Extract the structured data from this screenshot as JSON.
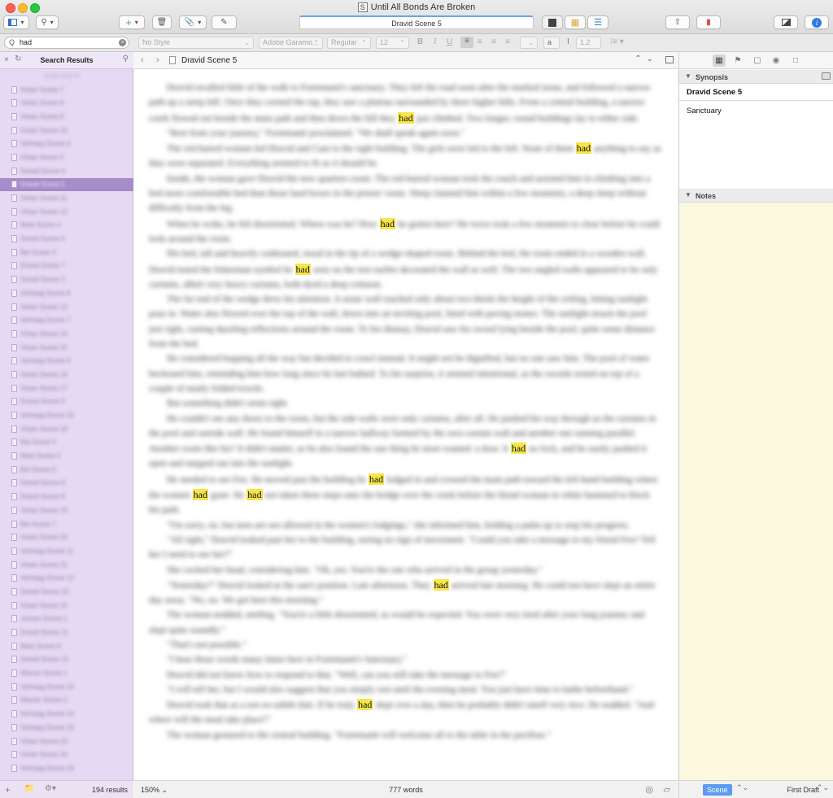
{
  "window": {
    "title": "Until All Bonds Are Broken",
    "doc_field": "Dravid Scene 5"
  },
  "search": {
    "query": "had"
  },
  "format_bar": {
    "style": "No Style",
    "font": "Adobe Garamo...",
    "weight": "Regular",
    "size": "12",
    "bold": "B",
    "italic": "I",
    "underline": "U",
    "text_color": "a",
    "line_spacing": "1.2"
  },
  "binder": {
    "header_title": "Search Results",
    "top_item": "Draft Only R",
    "items": [
      "Vivian Scene 7",
      "Vivian Scene 8",
      "Vivian Scene 9",
      "Vivian Scene 10",
      "Verhaag Scene 4",
      "Vivian Scene 5",
      "Dravid Scene 4",
      "Dravid Scene 5",
      "Vivian Scene 11",
      "Vivian Scene 12",
      "Mark Scene 4",
      "Dravid Scene 6",
      "Bet Scene 4",
      "Dravid Scene 7",
      "Dravid Scene 2",
      "Verhaag Scene 8",
      "Vivian Scene 13",
      "Verhaag Scene 7",
      "Vivian Scene 14",
      "Vivian Scene 15",
      "Verhaag Scene 9",
      "Vivian Scene 16",
      "Vivian Scene 17",
      "Dravid Scene 3",
      "Verhaag Scene 10",
      "Vivian Scene 18",
      "Bet Scene 5",
      "Mark Scene 5",
      "Bet Scene 6",
      "Dravid Scene 8",
      "Dravid Scene 9",
      "Vivian Scene 19",
      "Bet Scene 7",
      "Vivian Scene 20",
      "Verhaag Scene 11",
      "Vivian Scene 21",
      "Verhaag Scene 12",
      "Dravid Scene 10",
      "Vivian Scene 22",
      "Jensen Scene 1",
      "Dravid Scene 11",
      "Mark Scene 6",
      "Dravid Scene 12",
      "Warner Scene 1",
      "Verhaag Scene 13",
      "Warner Scene 2",
      "Verhaag Scene 14",
      "Verhaag Scene 15",
      "Vivian Scene 23",
      "Vivian Scene 24",
      "Verhaag Scene 16"
    ],
    "selected_index": 7,
    "result_count": "194 results"
  },
  "editor": {
    "title": "Dravid Scene 5",
    "zoom": "150%",
    "word_count": "777 words",
    "highlight": "had",
    "paragraphs": [
      {
        "segments": [
          "Dravid recalled little of the walk to Fortemanti's sanctuary. They left the road soon after the marked stone, and followed a narrow path up a steep hill. Once they crested the top, they saw a plateau surrounded by three higher hills. From a central building, a narrow creek flowed out beside the main path and then down the hill they ",
          "had",
          " just climbed. Two longer, round buildings lay to either side."
        ]
      },
      {
        "segments": [
          "\"Rest from your journey,\" Fortemanti proclaimed. \"We shall speak again soon.\""
        ]
      },
      {
        "segments": [
          "The red-haired woman led Dravid and Cam to the right building. The girls were led to the left. None of them ",
          "had",
          " anything to say as they were separated. Everything seemed to fit as it should be."
        ]
      },
      {
        "segments": [
          "Inside, the woman gave Dravid the new quarters room. The red-haired woman took the couch and assisted him in climbing into a bed more comfortable bed than those hard boxes in the priests' room. Sleep claimed him within a few moments, a deep sleep without difficulty from the leg."
        ]
      },
      {
        "segments": [
          "When he woke, he felt disoriented. Where was he? How ",
          "had",
          " he gotten here? He twice took a few moments to clear before he could look around the room."
        ]
      },
      {
        "segments": [
          "His bed, tall and heavily cushioned, stood in the tip of a wedge-shaped room. Behind the bed, the room ended in a wooden wall. Dravid noted the fisherman symbol he ",
          "had",
          " seen on the tree earlier decorated the wall as well. The two angled walls appeared to be only curtains, albeit very heavy curtains, both dyed a deep crimson."
        ]
      },
      {
        "segments": [
          "The far end of the wedge drew his attention. A stone wall reached only about two-thirds the height of the ceiling, letting sunlight pour in. Water also flowed over the top of the wall, down into an inviting pool, lined with paving stones. The sunlight struck the pool just right, casting dazzling reflections around the room. To his dismay, Dravid saw his sword lying beside the pool, quite some distance from the bed."
        ]
      },
      {
        "segments": [
          "He considered hopping all the way but decided to crawl instead. It might not be dignified, but no one saw him. The pool of water beckoned him, reminding him how long since he last bathed. To his surprise, it seemed intentional, as the swords rested on top of a couple of neatly folded towels."
        ]
      },
      {
        "segments": [
          "But something didn't seem right."
        ]
      },
      {
        "segments": [
          "He couldn't see any doors to the room, but the side walls were only curtains, after all. He pushed his way through as the curtains in the pool and outside wall. He found himself in a narrow hallway formed by the own curtain wall and another one running parallel. Another room like his? It didn't matter, as he also found the one thing he most wanted: a door. It ",
          "had",
          " no lock, and he easily pushed it open and stepped out into the sunlight."
        ]
      },
      {
        "segments": [
          "He needed to see Fen. He moved past the building he ",
          "had",
          " lodged in and crossed the main path toward the left-hand building where the women ",
          "had",
          " gone. He ",
          "had",
          " not taken three steps onto the bridge over the creek before the blond woman in white hastened to block his path."
        ]
      },
      {
        "segments": [
          "\"I'm sorry, sir, but men are not allowed in the women's lodgings,\" she informed him, holding a palm up to stop his progress."
        ]
      },
      {
        "segments": [
          "\"All right,\" Dravid looked past her to the building, seeing no sign of movement. \"Could you take a message to my friend Fen? Tell her I need to see her?\""
        ]
      },
      {
        "segments": [
          "She cocked her head, considering him. \"Oh, yes. You're the one who arrived in the group yesterday.\""
        ]
      },
      {
        "segments": [
          "\"Yesterday?\" Dravid looked at the sun's position. Late afternoon. They ",
          "had",
          " arrived late morning. He could not have slept an entire day away. \"No, no. We got here this morning.\""
        ]
      },
      {
        "segments": [
          "The woman nodded, smiling. \"You're a little disoriented, as would be expected. You were very tired after your long journey and slept quite soundly.\""
        ]
      },
      {
        "segments": [
          "\"That's not possible.\""
        ]
      },
      {
        "segments": [
          "\"I hear those words many times here in Fortemanti's Sanctuary.\""
        ]
      },
      {
        "segments": [
          "Dravid did not know how to respond to that. \"Well, can you still take the message to Fen?\""
        ]
      },
      {
        "segments": [
          "\"I will tell her, but I would also suggest that you simply rest until the evening meal. You just have time to bathe beforehand.\""
        ]
      },
      {
        "segments": [
          "Dravid took that as a not-so-subtle hint. If he truly ",
          "had",
          " slept over a day, then he probably didn't smell very nice. He nodded. \"And where will the meal take place?\""
        ]
      },
      {
        "segments": [
          "The woman gestured to the central building. \"Fortemanti will welcome all to the table in the pavilion.\""
        ]
      }
    ]
  },
  "inspector": {
    "synopsis_label": "Synopsis",
    "synopsis_title": "Dravid Scene 5",
    "synopsis_text": "Sanctuary",
    "notes_label": "Notes",
    "status": "Scene",
    "draft": "First Draft"
  },
  "colors": {
    "accent": "#5b9bf0",
    "binder_bg": "#e6d9f3",
    "selection": "#a68cc8",
    "highlight": "#f6e54b",
    "notes_bg": "#fbf8dd"
  }
}
